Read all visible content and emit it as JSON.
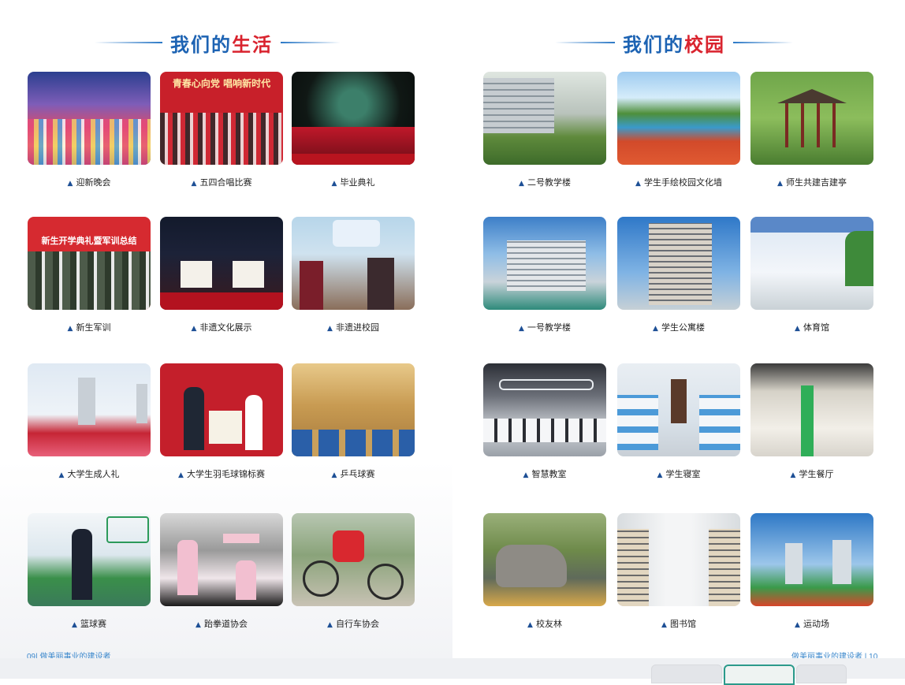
{
  "left_page": {
    "title_part1": "我们的",
    "title_part2": "生活",
    "footer": "09| 做美丽事业的建设者",
    "items": [
      {
        "caption": "迎新晚会",
        "banner": ""
      },
      {
        "caption": "五四合唱比赛",
        "banner": "青春心向党  唱响新时代"
      },
      {
        "caption": "毕业典礼",
        "banner": ""
      },
      {
        "caption": "新生军训",
        "banner": "新生开学典礼暨军训总结"
      },
      {
        "caption": "非遗文化展示",
        "banner": ""
      },
      {
        "caption": "非遗进校园",
        "banner": ""
      },
      {
        "caption": "大学生成人礼",
        "banner": ""
      },
      {
        "caption": "大学生羽毛球锦标赛",
        "banner": ""
      },
      {
        "caption": "乒乓球赛",
        "banner": ""
      },
      {
        "caption": "篮球赛",
        "banner": ""
      },
      {
        "caption": "跆拳道协会",
        "banner": ""
      },
      {
        "caption": "自行车协会",
        "banner": ""
      }
    ]
  },
  "right_page": {
    "title_part1": "我们的",
    "title_part2": "校园",
    "footer": "做美丽事业的建设者 | 10",
    "items": [
      {
        "caption": "二号教学楼"
      },
      {
        "caption": "学生手绘校园文化墙"
      },
      {
        "caption": "师生共建吉建亭"
      },
      {
        "caption": "一号教学楼"
      },
      {
        "caption": "学生公寓楼"
      },
      {
        "caption": "体育馆"
      },
      {
        "caption": "智慧教室"
      },
      {
        "caption": "学生寝室"
      },
      {
        "caption": "学生餐厅"
      },
      {
        "caption": "校友林"
      },
      {
        "caption": "图书馆"
      },
      {
        "caption": "运动场"
      }
    ]
  },
  "colors": {
    "title_blue": "#1d63b3",
    "title_red": "#d9232e",
    "caption_triangle": "#1d4f95",
    "footer": "#3c88cc"
  },
  "caption_marker": "▲"
}
